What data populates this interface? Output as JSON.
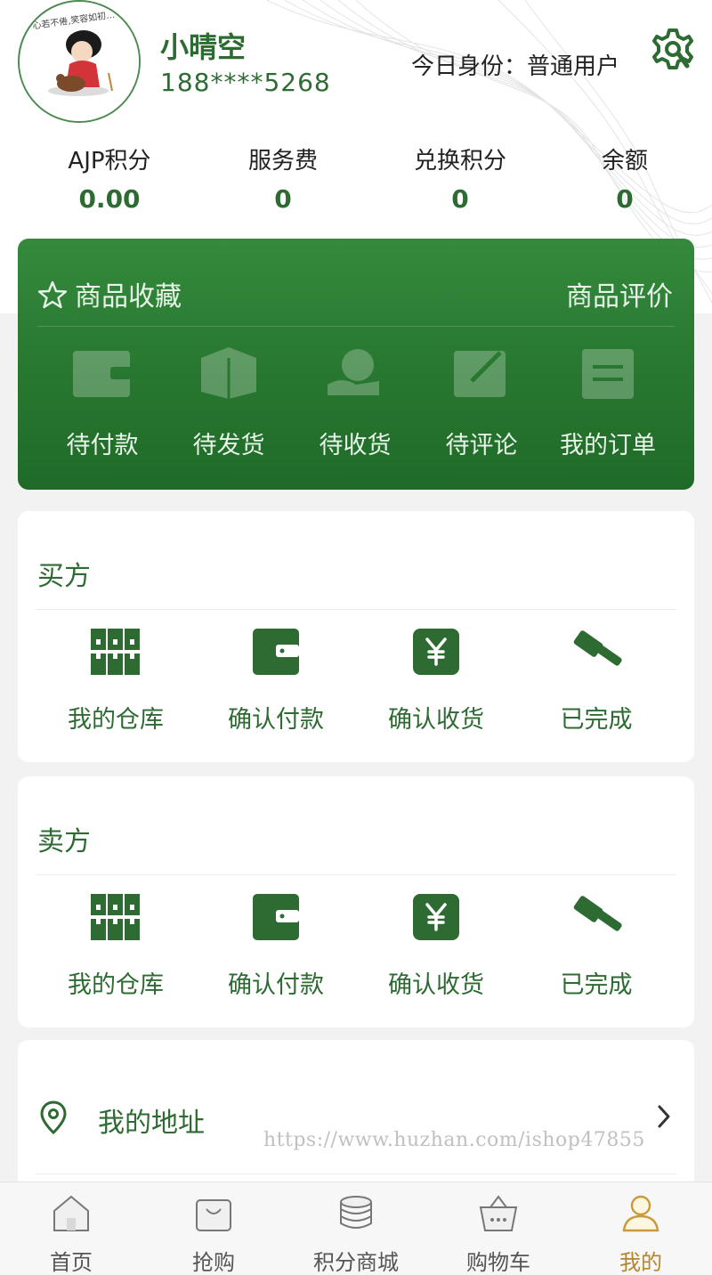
{
  "profile": {
    "name": "小晴空",
    "phone": "188****5268",
    "identity": "今日身份：普通用户",
    "avatar_caption": "心若不倦,笑容如初…"
  },
  "stats": [
    {
      "label": "AJP积分",
      "value": "0.00"
    },
    {
      "label": "服务费",
      "value": "0"
    },
    {
      "label": "兑换积分",
      "value": "0"
    },
    {
      "label": "余额",
      "value": "0"
    }
  ],
  "orders": {
    "favorites_label": "商品收藏",
    "review_label": "商品评价",
    "items": [
      {
        "label": "待付款",
        "icon": "wallet-icon"
      },
      {
        "label": "待发货",
        "icon": "box-icon"
      },
      {
        "label": "待收货",
        "icon": "receive-icon"
      },
      {
        "label": "待评论",
        "icon": "comment-icon"
      },
      {
        "label": "我的订单",
        "icon": "order-icon"
      }
    ]
  },
  "buyer": {
    "title": "买方",
    "items": [
      {
        "label": "我的仓库",
        "icon": "warehouse-icon"
      },
      {
        "label": "确认付款",
        "icon": "wallet-icon"
      },
      {
        "label": "确认收货",
        "icon": "yen-icon"
      },
      {
        "label": "已完成",
        "icon": "gavel-icon"
      }
    ]
  },
  "seller": {
    "title": "卖方",
    "items": [
      {
        "label": "我的仓库",
        "icon": "warehouse-icon"
      },
      {
        "label": "确认付款",
        "icon": "wallet-icon"
      },
      {
        "label": "确认收货",
        "icon": "yen-icon"
      },
      {
        "label": "已完成",
        "icon": "gavel-icon"
      }
    ]
  },
  "address": {
    "label": "我的地址"
  },
  "watermark": "https://www.huzhan.com/ishop47855",
  "tabbar": {
    "items": [
      {
        "label": "首页",
        "icon": "home-icon"
      },
      {
        "label": "抢购",
        "icon": "bag-icon"
      },
      {
        "label": "积分商城",
        "icon": "coins-icon"
      },
      {
        "label": "购物车",
        "icon": "basket-icon"
      },
      {
        "label": "我的",
        "icon": "user-icon"
      }
    ],
    "active_label": "我的"
  },
  "colors": {
    "brand_green": "#2e6b33",
    "card_green": "#2a7a32",
    "active_tab": "#b3862b"
  }
}
